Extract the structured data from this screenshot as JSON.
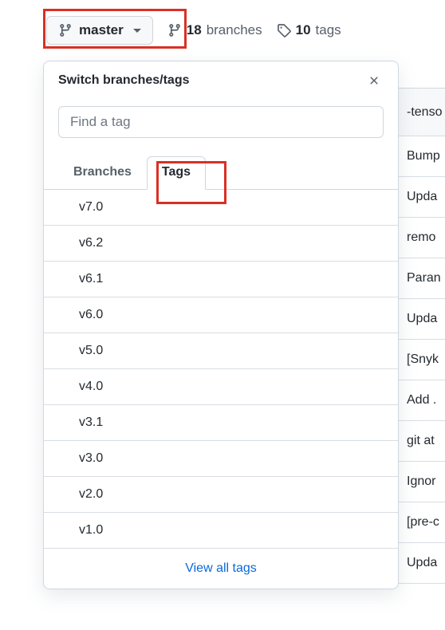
{
  "toolbar": {
    "branch_button_label": "master",
    "branches_count": "18",
    "branches_label": "branches",
    "tags_count": "10",
    "tags_label": "tags"
  },
  "dropdown": {
    "title": "Switch branches/tags",
    "search_placeholder": "Find a tag",
    "tabs": {
      "branches": "Branches",
      "tags": "Tags"
    },
    "tag_items": [
      "v7.0",
      "v6.2",
      "v6.1",
      "v6.0",
      "v5.0",
      "v4.0",
      "v3.1",
      "v3.0",
      "v2.0",
      "v1.0"
    ],
    "view_all_label": "View all tags"
  },
  "background_rows": [
    "-tenso",
    "Bump",
    "Upda",
    "remo",
    "Paran",
    "Upda",
    "[Snyk",
    "Add .",
    "git at",
    "Ignor",
    "[pre-c",
    "Upda"
  ]
}
